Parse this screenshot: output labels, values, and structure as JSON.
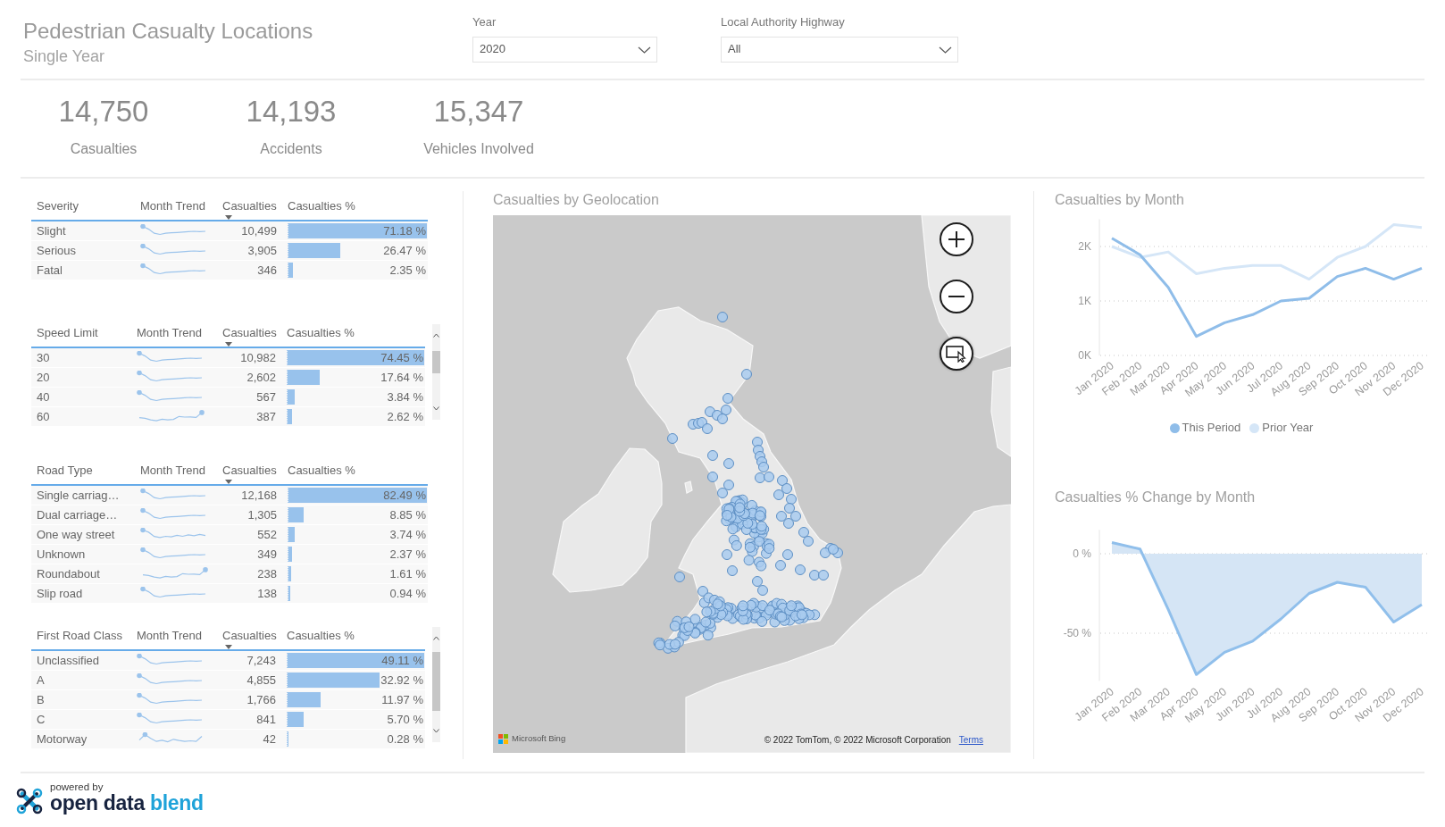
{
  "header": {
    "title": "Pedestrian Casualty Locations",
    "subtitle": "Single Year"
  },
  "filters": [
    {
      "label": "Year",
      "value": "2020"
    },
    {
      "label": "Local Authority Highway",
      "value": "All"
    }
  ],
  "kpis": [
    {
      "value": "14,750",
      "label": "Casualties"
    },
    {
      "value": "14,193",
      "label": "Accidents"
    },
    {
      "value": "15,347",
      "label": "Vehicles Involved"
    }
  ],
  "tables": [
    {
      "scrollable": false,
      "columns": [
        {
          "label": "Severity",
          "sorted": false
        },
        {
          "label": "Month Trend",
          "sorted": false
        },
        {
          "label": "Casualties",
          "sorted": true
        },
        {
          "label": "Casualties %",
          "sorted": false
        }
      ],
      "rows": [
        {
          "label": "Slight",
          "casualties": "10,499",
          "share": "71.18 %",
          "level": 1
        },
        {
          "label": "Serious",
          "casualties": "3,905",
          "share": "26.47 %",
          "level": 0.372
        },
        {
          "label": "Fatal",
          "casualties": "346",
          "share": "2.35 %",
          "level": 0.033
        }
      ]
    },
    {
      "scrollable": true,
      "columns": [
        {
          "label": "Speed Limit",
          "sorted": false
        },
        {
          "label": "Month Trend",
          "sorted": false
        },
        {
          "label": "Casualties",
          "sorted": true
        },
        {
          "label": "Casualties %",
          "sorted": false
        }
      ],
      "rows": [
        {
          "label": "30",
          "casualties": "10,982",
          "share": "74.45 %",
          "level": 1
        },
        {
          "label": "20",
          "casualties": "2,602",
          "share": "17.64 %",
          "level": 0.237
        },
        {
          "label": "40",
          "casualties": "567",
          "share": "3.84 %",
          "level": 0.052
        },
        {
          "label": "60",
          "casualties": "387",
          "share": "2.62 %",
          "level": 0.035
        }
      ]
    },
    {
      "scrollable": false,
      "columns": [
        {
          "label": "Road Type",
          "sorted": false
        },
        {
          "label": "Month Trend",
          "sorted": false
        },
        {
          "label": "Casualties",
          "sorted": true
        },
        {
          "label": "Casualties %",
          "sorted": false
        }
      ],
      "rows": [
        {
          "label": "Single carriag…",
          "casualties": "12,168",
          "share": "82.49 %",
          "level": 1
        },
        {
          "label": "Dual carriage…",
          "casualties": "1,305",
          "share": "8.85 %",
          "level": 0.107
        },
        {
          "label": "One way street",
          "casualties": "552",
          "share": "3.74 %",
          "level": 0.045
        },
        {
          "label": "Unknown",
          "casualties": "349",
          "share": "2.37 %",
          "level": 0.029
        },
        {
          "label": "Roundabout",
          "casualties": "238",
          "share": "1.61 %",
          "level": 0.02
        },
        {
          "label": "Slip road",
          "casualties": "138",
          "share": "0.94 %",
          "level": 0.011
        }
      ]
    },
    {
      "scrollable": true,
      "columns": [
        {
          "label": "First Road Class",
          "sorted": false
        },
        {
          "label": "Month Trend",
          "sorted": false
        },
        {
          "label": "Casualties",
          "sorted": true
        },
        {
          "label": "Casualties %",
          "sorted": false
        }
      ],
      "rows": [
        {
          "label": "Unclassified",
          "casualties": "7,243",
          "share": "49.11 %",
          "level": 1
        },
        {
          "label": "A",
          "casualties": "4,855",
          "share": "32.92 %",
          "level": 0.67
        },
        {
          "label": "B",
          "casualties": "1,766",
          "share": "11.97 %",
          "level": 0.244
        },
        {
          "label": "C",
          "casualties": "841",
          "share": "5.70 %",
          "level": 0.116
        },
        {
          "label": "Motorway",
          "casualties": "42",
          "share": "0.28 %",
          "level": 0.006
        }
      ]
    }
  ],
  "map": {
    "title": "Casualties by Geolocation",
    "provider": "Microsoft Bing",
    "copyright": "© 2022 TomTom, © 2022 Microsoft Corporation",
    "terms": "Terms"
  },
  "charts": [
    {
      "chart_data": {
        "type": "line",
        "title": "Casualties by Month",
        "categories": [
          "Jan 2020",
          "Feb 2020",
          "Mar 2020",
          "Apr 2020",
          "May 2020",
          "Jun 2020",
          "Jul 2020",
          "Aug 2020",
          "Sep 2020",
          "Oct 2020",
          "Nov 2020",
          "Dec 2020"
        ],
        "series": [
          {
            "name": "This Period",
            "color": "#8fbde9",
            "values": [
              2150,
              1850,
              1250,
              350,
              600,
              750,
              1000,
              1050,
              1450,
              1600,
              1400,
              1600
            ]
          },
          {
            "name": "Prior Year",
            "color": "#d5e6f7",
            "values": [
              2000,
              1800,
              1900,
              1500,
              1600,
              1650,
              1650,
              1400,
              1800,
              2000,
              2400,
              2350
            ]
          }
        ],
        "ylim": [
          0,
          2500
        ],
        "yticks": [
          {
            "value": 0,
            "label": "0K"
          },
          {
            "value": 1000,
            "label": "1K"
          },
          {
            "value": 2000,
            "label": "2K"
          }
        ],
        "legend": "bottom"
      }
    },
    {
      "chart_data": {
        "type": "area",
        "title": "Casualties % Change by Month",
        "categories": [
          "Jan 2020",
          "Feb 2020",
          "Mar 2020",
          "Apr 2020",
          "May 2020",
          "Jun 2020",
          "Jul 2020",
          "Aug 2020",
          "Sep 2020",
          "Oct 2020",
          "Nov 2020",
          "Dec 2020"
        ],
        "values": [
          7,
          3,
          -35,
          -76,
          -62,
          -55,
          -41,
          -25,
          -18,
          -21,
          -43,
          -32
        ],
        "ylim": [
          -80,
          15
        ],
        "yticks": [
          {
            "value": 0,
            "label": "0 %"
          },
          {
            "value": -50,
            "label": "-50 %"
          }
        ]
      }
    }
  ],
  "footer": {
    "powered_by": "powered by",
    "brand": "open data",
    "brand_accent": "blend"
  }
}
